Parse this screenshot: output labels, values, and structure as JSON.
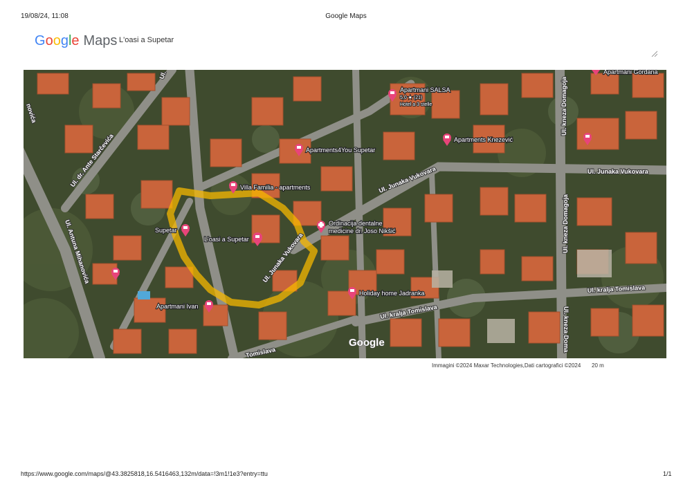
{
  "header": {
    "datetime": "19/08/24, 11:08",
    "page_title": "Google Maps"
  },
  "brand": {
    "logo_letters": [
      "G",
      "o",
      "o",
      "g",
      "l",
      "e"
    ],
    "logo_suffix": "Maps",
    "colors": {
      "blue": "#4285F4",
      "red": "#EA4335",
      "yellow": "#FBBC05",
      "green": "#34A853"
    }
  },
  "search": {
    "query": "L'oasi a Supetar"
  },
  "map": {
    "pin_color": "#E8447A",
    "highlight_color": "#F6B700",
    "places": {
      "apartmani_gordana": "Apartmani Gordana",
      "apartmani_salsa": "Apartmani SALSA",
      "salsa_rating": "5,0 ★ (21)",
      "salsa_type": "Hotel a 3 stelle",
      "apartments_knezevic": "Apartments Knezević",
      "apartments4you": "Apartments4You Supetar",
      "villa_familia": "Villa Familia - apartments",
      "ordinacija_line1": "Ordinacija dentalne",
      "ordinacija_line2": "medicine dr. Joso Nikšić",
      "supetar": "Supetar",
      "loasi": "L'oasi a Supetar",
      "apartmani_ivan": "Apartmani Ivan",
      "holiday_home": "Holiday home Jadranka"
    },
    "roads": {
      "ante_starcevica": "Ul. dr. Ante Starčevića",
      "antuna_mihanovica": "Ul. Antuna Mihanovića",
      "junaka_vukovara": "Ul. Junaka Vukovara",
      "kneza_domagoja": "Ul. kneza Domagoja",
      "kralja_tomislava": "Ul. kralja Tomislava",
      "tomislava_cut": "Tomislava",
      "mihanovica_cut": "novića",
      "top_ul": "Ul.",
      "domagoja_cut": "Ul. kneza Doma"
    },
    "watermark": "Google"
  },
  "attribution": "Immagini ©2024 Maxar Technologies,Dati cartografici ©2024",
  "scale_label": "20 m",
  "footer": {
    "url": "https://www.google.com/maps/@43.3825818,16.5416463,132m/data=!3m1!1e3?entry=ttu",
    "page": "1/1"
  }
}
